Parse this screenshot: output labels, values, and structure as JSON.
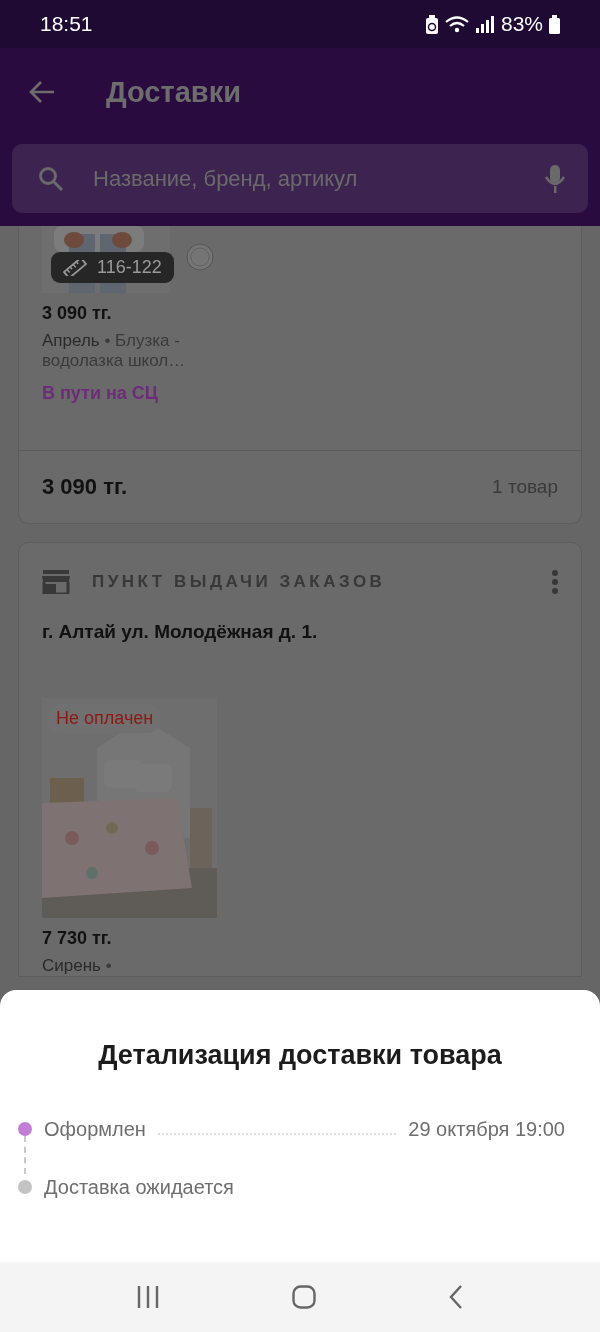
{
  "status_bar": {
    "time": "18:51",
    "battery": "83%"
  },
  "app_bar": {
    "title": "Доставки"
  },
  "search": {
    "placeholder": "Название, бренд, артикул"
  },
  "deliveries": [
    {
      "items": [
        {
          "price": "3 090 тг.",
          "seller": "Апрель",
          "name": "• Блузка - водолазка школ…",
          "size": "116-122",
          "status": "В пути на СЦ"
        }
      ],
      "total": "3 090 тг.",
      "count": "1 товар"
    },
    {
      "pickup_label": "ПУНКТ ВЫДАЧИ ЗАКАЗОВ",
      "address": "г. Алтай ул. Молодёжная д. 1.",
      "items": [
        {
          "price": "7 730 тг.",
          "seller": "Сирень",
          "name": "•",
          "badge": "Не оплачен"
        }
      ]
    }
  ],
  "sheet": {
    "title": "Детализация доставки товара",
    "steps": [
      {
        "label": "Оформлен",
        "date": "29 октября 19:00",
        "done": true
      },
      {
        "label": "Доставка ожидается",
        "done": false
      }
    ]
  }
}
